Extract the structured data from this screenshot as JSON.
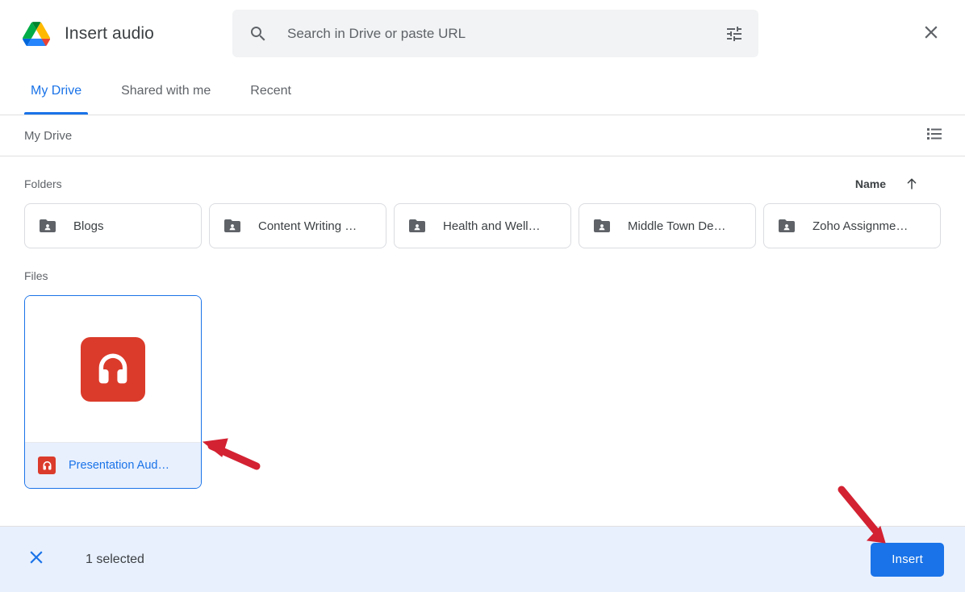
{
  "header": {
    "logo_icon": "google-drive-logo",
    "title": "Insert audio",
    "close_icon": "close-icon"
  },
  "search": {
    "icon": "search-icon",
    "placeholder": "Search in Drive or paste URL",
    "value": "",
    "filter_icon": "tune-icon"
  },
  "tabs": [
    {
      "label": "My Drive",
      "active": true
    },
    {
      "label": "Shared with me",
      "active": false
    },
    {
      "label": "Recent",
      "active": false
    }
  ],
  "breadcrumb": {
    "path": "My Drive",
    "view_toggle_icon": "list-view-icon"
  },
  "folders_section": {
    "label": "Folders",
    "sort": {
      "field_label": "Name",
      "direction_icon": "arrow-up-icon"
    },
    "items": [
      {
        "name": "Blogs",
        "icon": "shared-folder-icon"
      },
      {
        "name": "Content Writing …",
        "icon": "shared-folder-icon"
      },
      {
        "name": "Health and Well…",
        "icon": "shared-folder-icon"
      },
      {
        "name": "Middle Town De…",
        "icon": "shared-folder-icon"
      },
      {
        "name": "Zoho Assignme…",
        "icon": "shared-folder-icon"
      }
    ]
  },
  "files_section": {
    "label": "Files",
    "items": [
      {
        "name": "Presentation Aud…",
        "icon": "audio-headphones-icon",
        "selected": true,
        "icon_color": "#db3b2b"
      }
    ]
  },
  "footer": {
    "close_icon": "close-icon",
    "selection_text": "1 selected",
    "insert_label": "Insert"
  },
  "colors": {
    "accent_blue": "#1a73e8",
    "selected_bg": "#e8f0fe",
    "audio_red": "#db3b2b",
    "text_primary": "#3c4043",
    "text_secondary": "#5f6368",
    "annotation_red": "#d32232",
    "border": "#dadce0"
  },
  "annotations": [
    {
      "name": "arrow-pointing-to-file-card",
      "color": "#d32232"
    },
    {
      "name": "arrow-pointing-to-insert-button",
      "color": "#d32232"
    }
  ]
}
